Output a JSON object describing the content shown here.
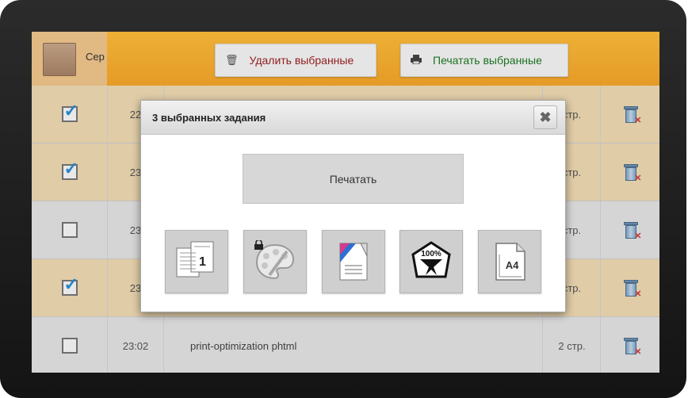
{
  "header": {
    "username": "Сер",
    "delete_label": "Удалить выбранные",
    "print_label": "Печатать выбранные"
  },
  "rows": [
    {
      "checked": true,
      "time": "22",
      "name": "",
      "pages": "стр."
    },
    {
      "checked": true,
      "time": "23",
      "name": "",
      "pages": "стр."
    },
    {
      "checked": false,
      "time": "23",
      "name": "",
      "pages": "стр."
    },
    {
      "checked": true,
      "time": "23",
      "name": "",
      "pages": "стр."
    },
    {
      "checked": false,
      "time": "23:02",
      "name": "print-optimization phtml",
      "pages": "2 стр."
    }
  ],
  "modal": {
    "title": "3 выбранных задания",
    "print_button": "Печатать",
    "tools": [
      {
        "icon": "copies-icon",
        "value": "1"
      },
      {
        "icon": "color-palette-icon",
        "locked": true
      },
      {
        "icon": "page-color-icon"
      },
      {
        "icon": "scale-100-icon",
        "value": "100%"
      },
      {
        "icon": "paper-size-icon",
        "value": "A4"
      }
    ]
  },
  "colors": {
    "header": "#f7a72a",
    "selected_row": "#f1dcb4",
    "delete_text": "#9b2222",
    "print_text": "#1d7a22",
    "check_mark": "#2c8fd6"
  }
}
